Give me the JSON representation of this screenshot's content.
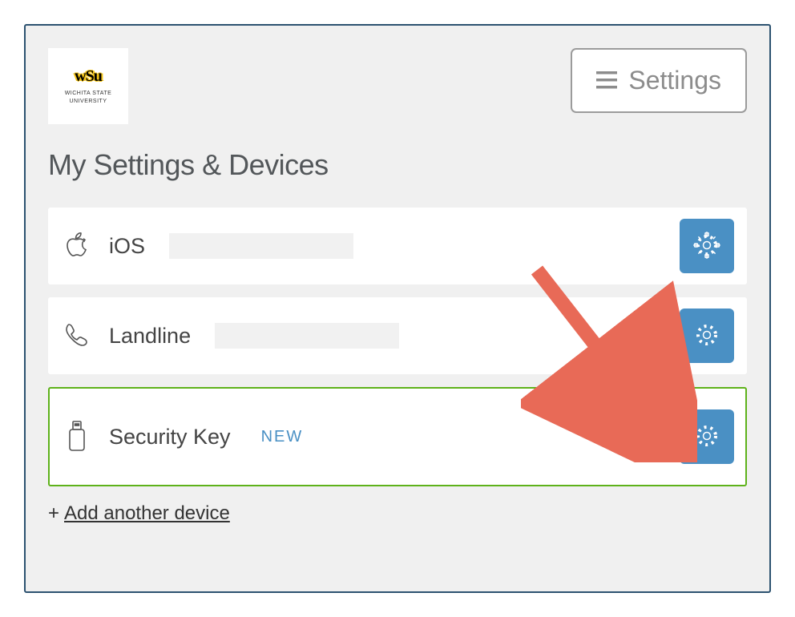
{
  "org": {
    "logo_mark": "wSu",
    "line1": "WICHITA STATE",
    "line2": "UNIVERSITY"
  },
  "header": {
    "settings_label": "Settings"
  },
  "title": "My Settings & Devices",
  "devices": [
    {
      "label": "iOS",
      "badge": ""
    },
    {
      "label": "Landline",
      "badge": ""
    },
    {
      "label": "Security Key",
      "badge": "NEW"
    }
  ],
  "add_device": {
    "plus": "+",
    "label": "Add another device"
  }
}
